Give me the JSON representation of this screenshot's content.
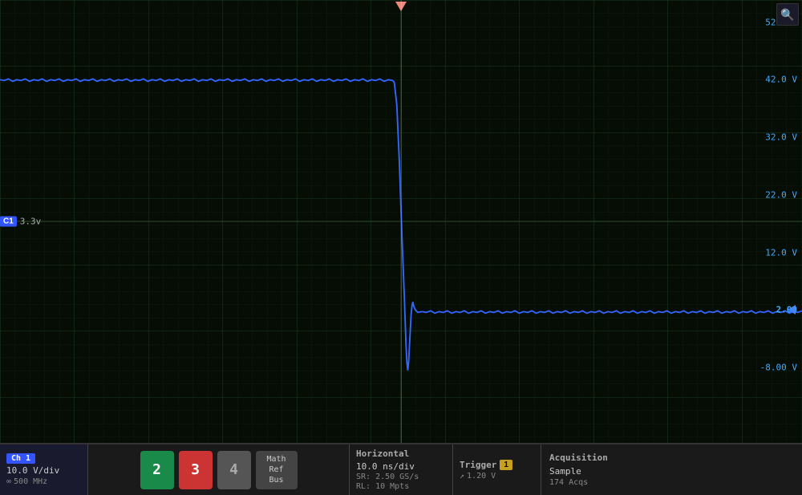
{
  "screen": {
    "y_labels": [
      {
        "value": "52.0 V",
        "pct": 5
      },
      {
        "value": "42.0 V",
        "pct": 18
      },
      {
        "value": "32.0 V",
        "pct": 31
      },
      {
        "value": "22.0 V",
        "pct": 44
      },
      {
        "value": "12.0 V",
        "pct": 57
      },
      {
        "value": "2.00",
        "pct": 70
      },
      {
        "value": "-8.00 V",
        "pct": 83
      }
    ],
    "channel_indicator": {
      "badge": "C1",
      "value": "3.3v"
    }
  },
  "toolbar": {
    "ch1": {
      "label": "Ch 1",
      "scale": "10.0 V/div",
      "bw_icon": "∞",
      "bandwidth": "500 MHz"
    },
    "channels": {
      "ch2": "2",
      "ch3": "3",
      "ch4": "4",
      "math_ref_bus": "Math\nRef\nBus"
    },
    "horizontal": {
      "title": "Horizontal",
      "time_div": "10.0 ns/div",
      "sample_rate": "SR: 2.50 GS/s",
      "record_length": "RL: 10 Mpts"
    },
    "trigger": {
      "title": "Trigger",
      "number": "1",
      "arrow_icon": "↗",
      "voltage": "1.20 V"
    },
    "acquisition": {
      "title": "Acquisition",
      "mode": "Sample",
      "acqs": "174 Acqs"
    }
  }
}
